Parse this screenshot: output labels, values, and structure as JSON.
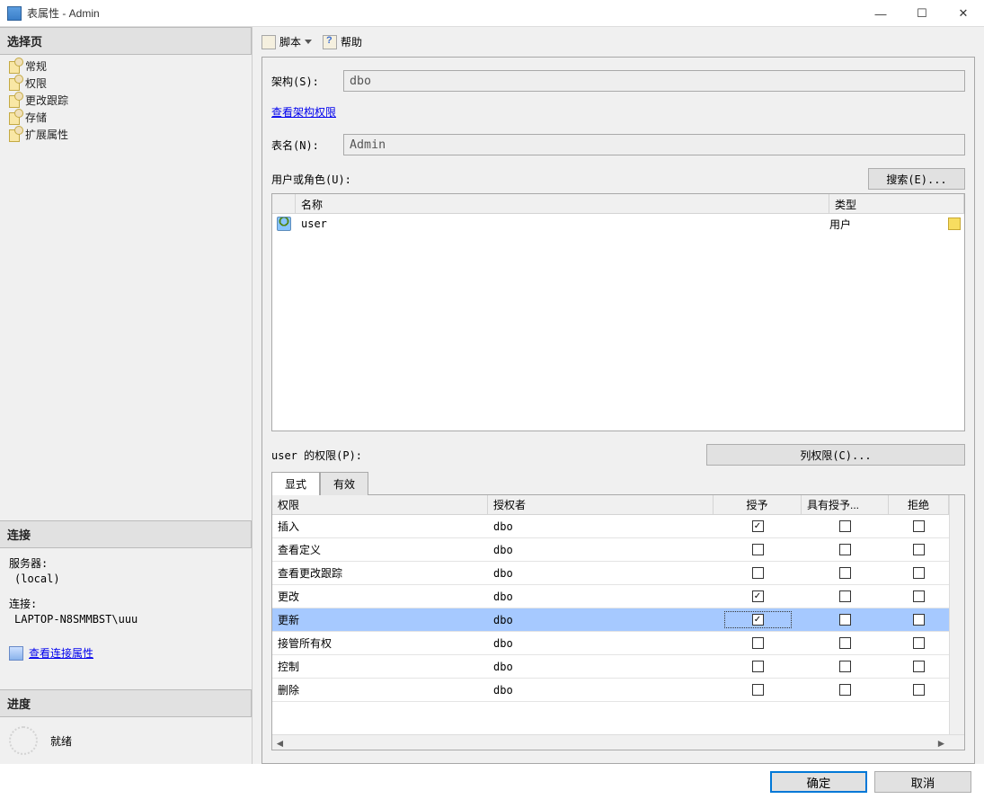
{
  "title": "表属性 - Admin",
  "sidebar": {
    "select_page": "选择页",
    "items": [
      "常规",
      "权限",
      "更改跟踪",
      "存储",
      "扩展属性"
    ],
    "connection_head": "连接",
    "server_lbl": "服务器:",
    "server_val": "(local)",
    "conn_lbl": "连接:",
    "conn_val": "LAPTOP-N8SMMBST\\uuu",
    "view_props": "查看连接属性",
    "progress_head": "进度",
    "ready": "就绪"
  },
  "toolbar": {
    "script": "脚本",
    "help": "帮助"
  },
  "form": {
    "schema_lbl": "架构(S):",
    "schema_val": "dbo",
    "view_schema_perms": "查看架构权限",
    "tablename_lbl": "表名(N):",
    "tablename_val": "Admin",
    "users_lbl": "用户或角色(U):",
    "search_btn": "搜索(E)...",
    "col_name": "名称",
    "col_type": "类型",
    "user_rows": [
      {
        "name": "user",
        "type": "用户"
      }
    ],
    "perms_lbl": "user 的权限(P):",
    "col_perms_btn": "列权限(C)...",
    "tab_explicit": "显式",
    "tab_effective": "有效",
    "ph_perm": "权限",
    "ph_grantor": "授权者",
    "ph_grant": "授予",
    "ph_wgrant": "具有授予...",
    "ph_deny": "拒绝",
    "perm_rows": [
      {
        "perm": "插入",
        "grantor": "dbo",
        "grant": true,
        "wgrant": false,
        "deny": false,
        "sel": false
      },
      {
        "perm": "查看定义",
        "grantor": "dbo",
        "grant": false,
        "wgrant": false,
        "deny": false,
        "sel": false
      },
      {
        "perm": "查看更改跟踪",
        "grantor": "dbo",
        "grant": false,
        "wgrant": false,
        "deny": false,
        "sel": false
      },
      {
        "perm": "更改",
        "grantor": "dbo",
        "grant": true,
        "wgrant": false,
        "deny": false,
        "sel": false
      },
      {
        "perm": "更新",
        "grantor": "dbo",
        "grant": true,
        "wgrant": false,
        "deny": false,
        "sel": true
      },
      {
        "perm": "接管所有权",
        "grantor": "dbo",
        "grant": false,
        "wgrant": false,
        "deny": false,
        "sel": false
      },
      {
        "perm": "控制",
        "grantor": "dbo",
        "grant": false,
        "wgrant": false,
        "deny": false,
        "sel": false
      },
      {
        "perm": "删除",
        "grantor": "dbo",
        "grant": false,
        "wgrant": false,
        "deny": false,
        "sel": false
      }
    ]
  },
  "buttons": {
    "ok": "确定",
    "cancel": "取消"
  }
}
